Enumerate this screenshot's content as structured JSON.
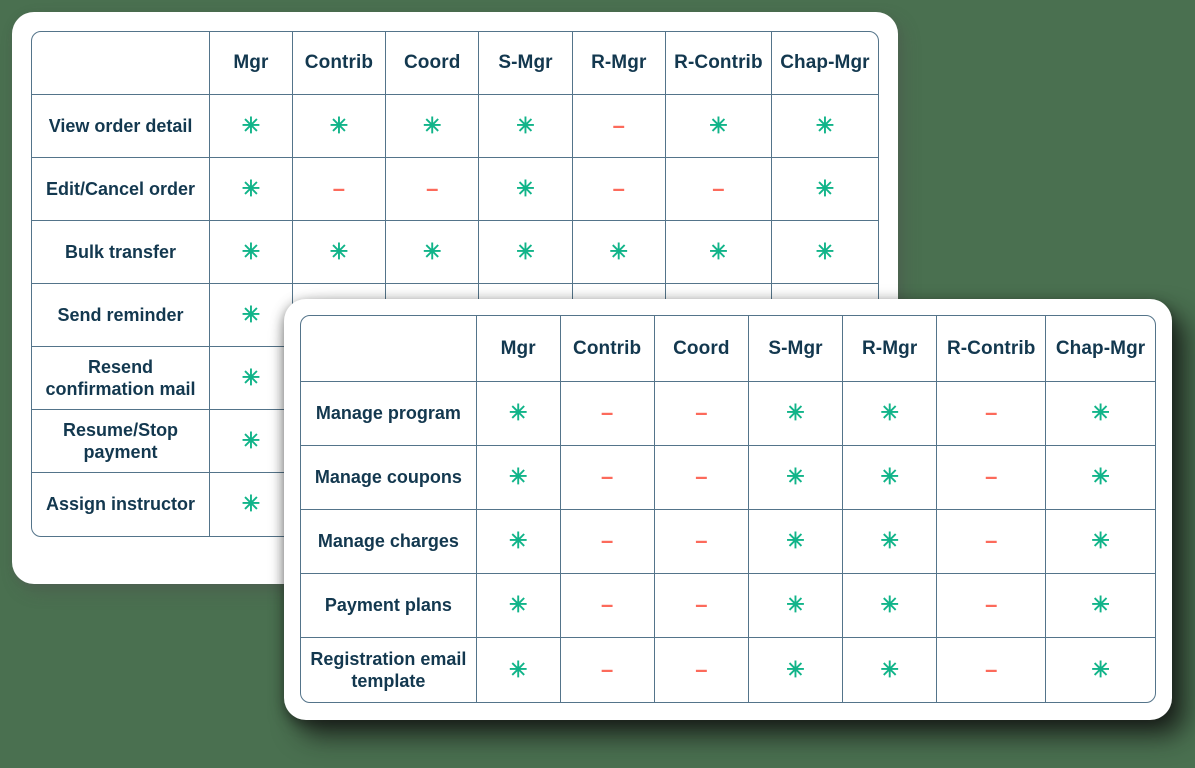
{
  "background_color": "#4a7050",
  "colors": {
    "card": "#ffffff",
    "border": "#54748a",
    "text": "#13384f",
    "yes": "#11b489",
    "no": "#fc6a5b"
  },
  "legend": {
    "yes_symbol": "✳",
    "no_symbol": "–"
  },
  "back_table": {
    "corner_header": "",
    "columns": [
      "Mgr",
      "Contrib",
      "Coord",
      "S-Mgr",
      "R-Mgr",
      "R-Contrib",
      "Chap-Mgr"
    ],
    "rows": [
      {
        "label": "View order detail",
        "values": [
          "yes",
          "yes",
          "yes",
          "yes",
          "no",
          "yes",
          "yes"
        ]
      },
      {
        "label": "Edit/Cancel order",
        "values": [
          "yes",
          "no",
          "no",
          "yes",
          "no",
          "no",
          "yes"
        ]
      },
      {
        "label": "Bulk transfer",
        "values": [
          "yes",
          "yes",
          "yes",
          "yes",
          "yes",
          "yes",
          "yes"
        ]
      },
      {
        "label": "Send reminder",
        "values": [
          "yes",
          "",
          "",
          "",
          "",
          "",
          ""
        ]
      },
      {
        "label": "Resend confirmation mail",
        "values": [
          "yes",
          "",
          "",
          "",
          "",
          "",
          ""
        ]
      },
      {
        "label": "Resume/Stop payment",
        "values": [
          "yes",
          "",
          "",
          "",
          "",
          "",
          ""
        ]
      },
      {
        "label": "Assign instructor",
        "values": [
          "yes",
          "",
          "",
          "",
          "",
          "",
          ""
        ]
      }
    ]
  },
  "front_table": {
    "corner_header": "",
    "columns": [
      "Mgr",
      "Contrib",
      "Coord",
      "S-Mgr",
      "R-Mgr",
      "R-Contrib",
      "Chap-Mgr"
    ],
    "rows": [
      {
        "label": "Manage program",
        "values": [
          "yes",
          "no",
          "no",
          "yes",
          "yes",
          "no",
          "yes"
        ]
      },
      {
        "label": "Manage coupons",
        "values": [
          "yes",
          "no",
          "no",
          "yes",
          "yes",
          "no",
          "yes"
        ]
      },
      {
        "label": "Manage charges",
        "values": [
          "yes",
          "no",
          "no",
          "yes",
          "yes",
          "no",
          "yes"
        ]
      },
      {
        "label": "Payment plans",
        "values": [
          "yes",
          "no",
          "no",
          "yes",
          "yes",
          "no",
          "yes"
        ]
      },
      {
        "label": "Registration email template",
        "values": [
          "yes",
          "no",
          "no",
          "yes",
          "yes",
          "no",
          "yes"
        ]
      }
    ]
  }
}
